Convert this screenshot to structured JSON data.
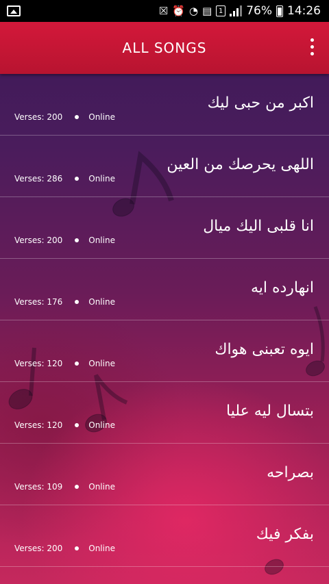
{
  "status_bar": {
    "battery_percent": "76%",
    "time": "14:26",
    "sim_label": "1"
  },
  "app_bar": {
    "title": "ALL SONGS",
    "menu_icon": "more-vert-icon"
  },
  "songs": [
    {
      "title": "اكبر من حبى ليك",
      "verses": "Verses: 200",
      "status": "Online"
    },
    {
      "title": "اللهى يحرصك من العين",
      "verses": "Verses: 286",
      "status": "Online"
    },
    {
      "title": "انا قلبى اليك ميال",
      "verses": "Verses: 200",
      "status": "Online"
    },
    {
      "title": "انهارده ايه",
      "verses": "Verses: 176",
      "status": "Online"
    },
    {
      "title": "ايوه تعبنى هواك",
      "verses": "Verses: 120",
      "status": "Online"
    },
    {
      "title": "بتسال ليه عليا",
      "verses": "Verses: 120",
      "status": "Online"
    },
    {
      "title": "بصراحه",
      "verses": "Verses: 109",
      "status": "Online"
    },
    {
      "title": "بفكر فيك",
      "verses": "Verses: 200",
      "status": "Online"
    }
  ]
}
